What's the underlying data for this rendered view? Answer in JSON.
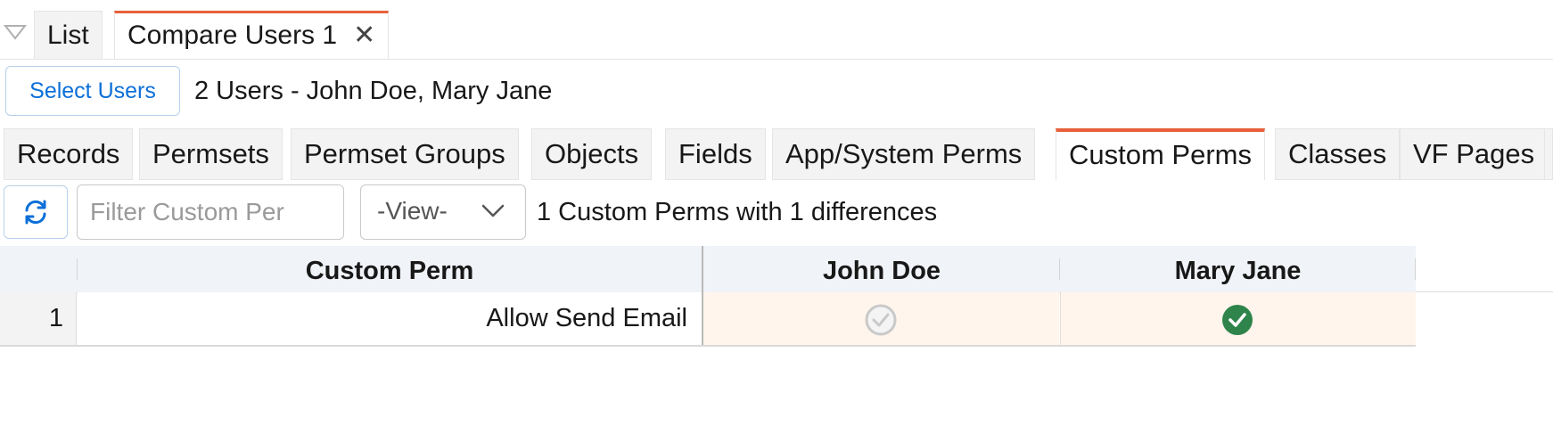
{
  "top_tabs": [
    {
      "label": "List"
    },
    {
      "label": "Compare Users 1",
      "close_icon": "close-icon"
    }
  ],
  "colors": {
    "accent": "#e8603c",
    "link": "#0b6fd8",
    "diff_bg": "#fff5ec",
    "check_green": "#2e844a",
    "check_gray": "#c9c9c9"
  },
  "users_bar": {
    "select_button": "Select Users",
    "summary": "2 Users - John Doe, Mary Jane"
  },
  "sub_tabs": [
    {
      "label": "Records"
    },
    {
      "label": "Permsets"
    },
    {
      "label": "Permset Groups"
    },
    {
      "label": "Objects"
    },
    {
      "label": "Fields"
    },
    {
      "label": "App/System Perms"
    },
    {
      "label": "Custom Perms",
      "active": true
    },
    {
      "label": "Classes"
    },
    {
      "label": "VF Pages"
    }
  ],
  "toolbar": {
    "refresh_icon": "refresh-icon",
    "filter_placeholder": "Filter Custom Per",
    "view_select": "-View-",
    "diff_summary": "1 Custom Perms with 1 differences"
  },
  "grid": {
    "columns": [
      "Custom Perm",
      "John Doe",
      "Mary Jane"
    ],
    "rows": [
      {
        "num": "1",
        "name": "Allow Send Email",
        "john_doe": "unchecked-icon",
        "mary_jane": "checked-icon"
      }
    ]
  }
}
